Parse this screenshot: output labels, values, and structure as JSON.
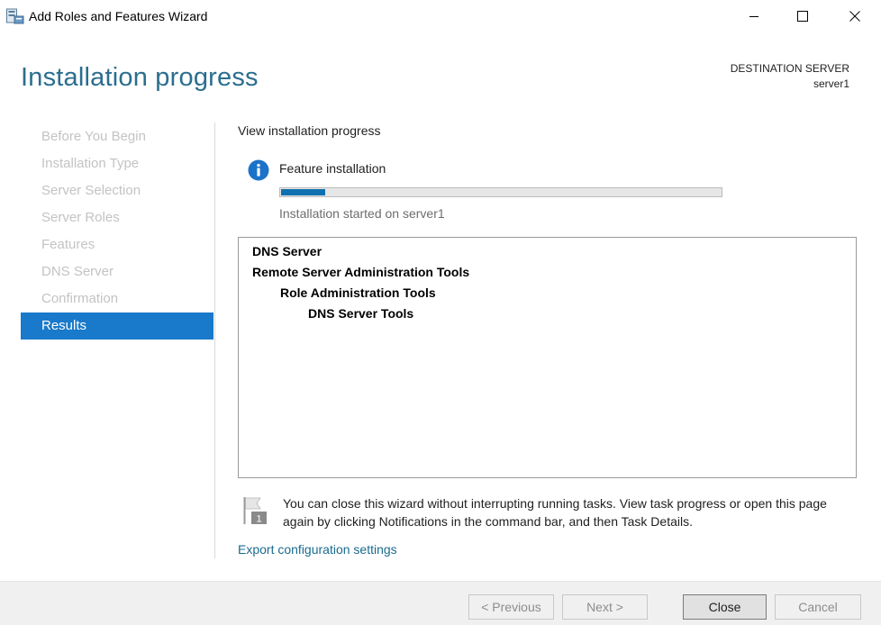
{
  "window": {
    "title": "Add Roles and Features Wizard"
  },
  "header": {
    "page_title": "Installation progress",
    "destination_label": "DESTINATION SERVER",
    "destination_value": "server1"
  },
  "nav": {
    "items": [
      {
        "label": "Before You Begin",
        "active": false
      },
      {
        "label": "Installation Type",
        "active": false
      },
      {
        "label": "Server Selection",
        "active": false
      },
      {
        "label": "Server Roles",
        "active": false
      },
      {
        "label": "Features",
        "active": false
      },
      {
        "label": "DNS Server",
        "active": false
      },
      {
        "label": "Confirmation",
        "active": false
      },
      {
        "label": "Results",
        "active": true
      }
    ]
  },
  "main": {
    "heading": "View installation progress",
    "feature_label": "Feature installation",
    "progress_fraction": 0.1,
    "status": "Installation started on server1",
    "results": [
      {
        "label": "DNS Server",
        "level": 0
      },
      {
        "label": "Remote Server Administration Tools",
        "level": 0
      },
      {
        "label": "Role Administration Tools",
        "level": 1
      },
      {
        "label": "DNS Server Tools",
        "level": 2
      }
    ],
    "notice": "You can close this wizard without interrupting running tasks. View task progress or open this page again by clicking Notifications in the command bar, and then Task Details.",
    "notification_count": "1",
    "export_link": "Export configuration settings"
  },
  "footer": {
    "previous_label": "< Previous",
    "next_label": "Next >",
    "close_label": "Close",
    "cancel_label": "Cancel"
  },
  "colors": {
    "accent": "#1979ca",
    "title": "#2b6e8f",
    "progress": "#0f70b0",
    "link": "#1a6b8f"
  },
  "icons": {
    "app": "server-manager-icon",
    "info": "info-icon",
    "notice": "flag-icon",
    "minimize": "minimize-icon",
    "maximize": "maximize-icon",
    "close": "close-icon"
  }
}
